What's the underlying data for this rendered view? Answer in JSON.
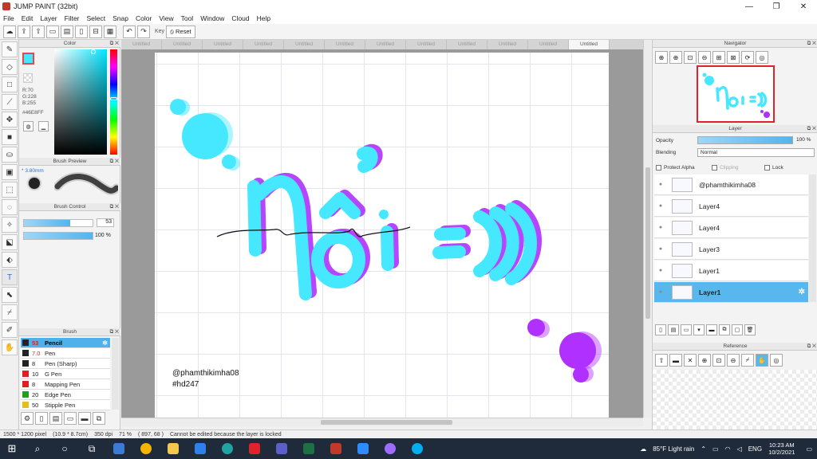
{
  "window": {
    "title": "JUMP PAINT (32bit)",
    "min": "—",
    "max": "❐",
    "close": "✕"
  },
  "menu": [
    "File",
    "Edit",
    "Layer",
    "Filter",
    "Select",
    "Snap",
    "Color",
    "View",
    "Tool",
    "Window",
    "Cloud",
    "Help"
  ],
  "toolbar": {
    "key_label": "Key",
    "reset_label": "Reset"
  },
  "tabs": [
    "Untitled",
    "Untitled",
    "Untitled",
    "Untitled",
    "Untitled",
    "Untitled",
    "Untitled",
    "Untitled",
    "Untitled",
    "Untitled",
    "Untitled",
    "Untitled"
  ],
  "panels": {
    "color": "Color",
    "brush_preview": "Brush Preview",
    "brush_control": "Brush Control",
    "brush": "Brush",
    "navigator": "Navigator",
    "layer": "Layer",
    "reference": "Reference"
  },
  "color": {
    "r": "R:70",
    "g": "G:228",
    "b": "B:255",
    "hex": "#46E8FF",
    "primary": "#46e8ff",
    "secondary": "#ffffff"
  },
  "brush_preview": {
    "size": "* 3.80mm"
  },
  "brush_control": {
    "size_value": "53",
    "size_fraction": 0.68,
    "opacity_value": "100 %",
    "opacity_fraction": 1.0
  },
  "brushes": [
    {
      "size": "53",
      "name": "Pencil",
      "color": "#222222",
      "selected": true
    },
    {
      "size": "7.0",
      "name": "Pen",
      "color": "#222222",
      "selected": false
    },
    {
      "size": "8",
      "name": "Pen (Sharp)",
      "color": "#222222",
      "selected": false
    },
    {
      "size": "10",
      "name": "G Pen",
      "color": "#e02020",
      "selected": false
    },
    {
      "size": "8",
      "name": "Mapping Pen",
      "color": "#e02020",
      "selected": false
    },
    {
      "size": "20",
      "name": "Edge Pen",
      "color": "#20a020",
      "selected": false
    },
    {
      "size": "50",
      "name": "Stipple Pen",
      "color": "#e0c020",
      "selected": false
    }
  ],
  "canvas": {
    "credit_user": "@phamthikimha08",
    "credit_tag": "#hd247",
    "main_text": "Nổi",
    "emote": "=)))",
    "accent_cyan": "#46e8ff",
    "accent_purple": "#b030ff"
  },
  "layer": {
    "opacity_label": "Opacity",
    "opacity_value": "100 %",
    "blending_label": "Blending",
    "blending_value": "Normal",
    "protect_alpha": "Protect Alpha",
    "clipping": "Clipping",
    "lock": "Lock",
    "layers": [
      {
        "name": "@phamthikimha08",
        "selected": false
      },
      {
        "name": "Layer4",
        "selected": false
      },
      {
        "name": "Layer4",
        "selected": false
      },
      {
        "name": "Layer3",
        "selected": false
      },
      {
        "name": "Layer1",
        "selected": false
      },
      {
        "name": "Layer1",
        "selected": true
      }
    ]
  },
  "status": {
    "size": "1500 * 1200 pixel",
    "physical": "(10.9 * 8.7cm)",
    "dpi": "350 dpi",
    "zoom": "71 %",
    "cursor": "( 897, 68 )",
    "message": "Cannot be edited because the layer is locked"
  },
  "taskbar": {
    "weather": "85°F Light rain",
    "lang": "ENG",
    "time": "10:23 AM",
    "date": "10/2/2021"
  }
}
